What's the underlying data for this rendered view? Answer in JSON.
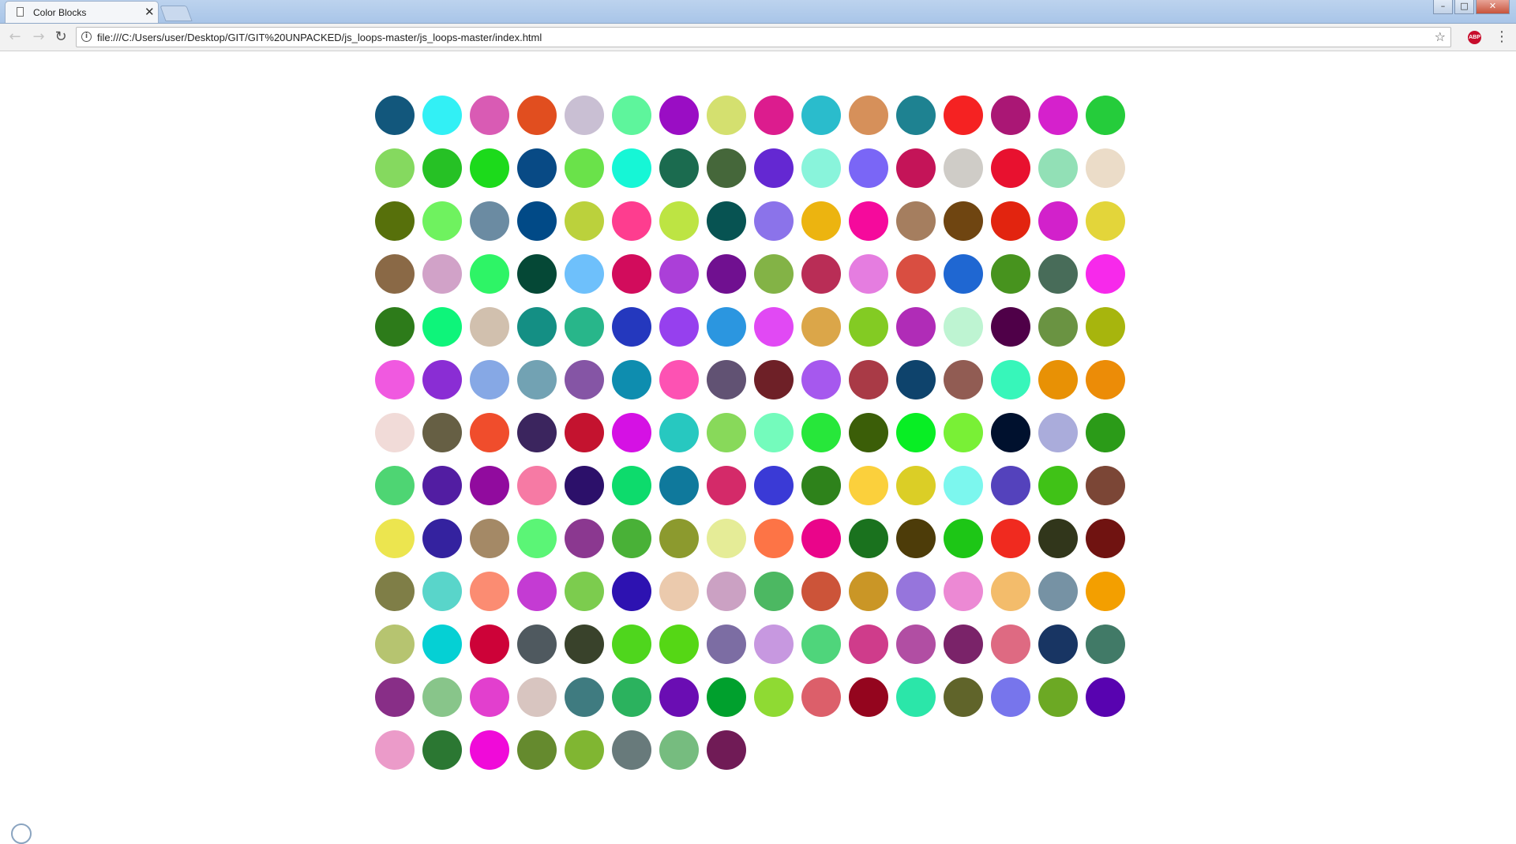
{
  "tab": {
    "title": "Color Blocks",
    "close_glyph": "✕"
  },
  "window_controls": {
    "minimize": "–",
    "maximize": "□",
    "close": "✕"
  },
  "toolbar": {
    "back": "←",
    "forward": "→",
    "reload": "↻",
    "url": "file:///C:/Users/user/Desktop/GIT/GIT%20UNPACKED/js_loops-master/js_loops-master/index.html",
    "info": "i",
    "star": "☆",
    "abp": "ABP",
    "menu": "⋮"
  },
  "icons": [
    "page-icon",
    "close-icon",
    "back-icon",
    "forward-icon",
    "reload-icon",
    "info-icon",
    "star-icon",
    "adblock-icon",
    "menu-icon"
  ],
  "page": {
    "columns": 16,
    "circles": [
      "#12577c",
      "#32f0f5",
      "#d95bb4",
      "#e14e1f",
      "#c9bfd3",
      "#5ef59c",
      "#9a0dc4",
      "#d4e06f",
      "#dc1c8e",
      "#2abccc",
      "#d6905a",
      "#1e8291",
      "#f52222",
      "#aa1775",
      "#d521cc",
      "#25cc3b",
      "#85d95f",
      "#26c125",
      "#1cda1b",
      "#084a85",
      "#6ae24a",
      "#16f6d6",
      "#1b6b4f",
      "#45673a",
      "#6428d2",
      "#89f4db",
      "#7a66f6",
      "#c41458",
      "#cfccc7",
      "#e8112f",
      "#92e0b6",
      "#ebdcc8",
      "#57700b",
      "#6ff25f",
      "#6b8ba2",
      "#014a87",
      "#bbd13c",
      "#fe3d8f",
      "#bde443",
      "#075352",
      "#8b73ea",
      "#ecb410",
      "#f50a9c",
      "#a57e5f",
      "#6f4511",
      "#e2240f",
      "#d221cb",
      "#e3d53a",
      "#8a6946",
      "#d1a2c8",
      "#2ef466",
      "#054836",
      "#6ec0fb",
      "#d20c5c",
      "#ab3fd8",
      "#701090",
      "#83b346",
      "#b92d56",
      "#e57de0",
      "#d94e41",
      "#1f67d2",
      "#47931e",
      "#486c59",
      "#f729eb",
      "#2d7b1a",
      "#0ef47a",
      "#d1c0ae",
      "#148f84",
      "#28b68a",
      "#2438be",
      "#9640ee",
      "#2b96e0",
      "#e149f4",
      "#dba649",
      "#83cb23",
      "#b02cb7",
      "#bef4d2",
      "#4f0048",
      "#6a9342",
      "#a7b50d",
      "#f059e0",
      "#8a2dd4",
      "#86a8e5",
      "#72a2b3",
      "#8555a5",
      "#0e8daf",
      "#fd52b3",
      "#615273",
      "#6e2027",
      "#a658ee",
      "#a93a46",
      "#0e436c",
      "#915c53",
      "#37f6ba",
      "#e89105",
      "#ec8c07",
      "#f1dbd8",
      "#665f44",
      "#f04d2c",
      "#3b255e",
      "#c4132f",
      "#d511e4",
      "#27c8c0",
      "#88d95a",
      "#74fbbc",
      "#27e73a",
      "#3b5e08",
      "#08ee24",
      "#79f036",
      "#00112e",
      "#aaacdb",
      "#2b9b18",
      "#4ed573",
      "#521da2",
      "#910b9e",
      "#f67aa4",
      "#2c106a",
      "#0ddb6c",
      "#0f799c",
      "#d42a69",
      "#3a3ad6",
      "#2e821b",
      "#fbd03c",
      "#dbce26",
      "#7cf7ee",
      "#5442bc",
      "#40c217",
      "#7b4636",
      "#ece54f",
      "#34229f",
      "#a48966",
      "#5bf576",
      "#8b3890",
      "#49b137",
      "#8c9a2e",
      "#e5ec97",
      "#fd7446",
      "#ea058a",
      "#1a721e",
      "#4d3c09",
      "#1dc616",
      "#f02a1f",
      "#31361b",
      "#701311",
      "#7f7e47",
      "#59d5ca",
      "#fb8c72",
      "#c43bd3",
      "#7ccc4e",
      "#2d12b1",
      "#ebcaad",
      "#cba1c3",
      "#4cb862",
      "#cc5439",
      "#ca9626",
      "#9675dc",
      "#ec89d4",
      "#f3bc6b",
      "#7692a4",
      "#f39f00",
      "#b6c470",
      "#05d0d4",
      "#cd0238",
      "#4f595f",
      "#39422b",
      "#4fd61d",
      "#55d715",
      "#7c6da3",
      "#c798e0",
      "#4fd57b",
      "#cf3c8b",
      "#b14ea3",
      "#7a2369",
      "#de6a82",
      "#183563",
      "#417a67",
      "#882e87",
      "#88c58a",
      "#e23fce",
      "#d8c5c0",
      "#3f7b80",
      "#2bb25e",
      "#6a0db3",
      "#00a02d",
      "#8fda33",
      "#dc5f6a",
      "#94051e",
      "#2be6a9",
      "#60642a",
      "#7775ec",
      "#6ca924",
      "#5803b0",
      "#eb9bc9",
      "#2b7732",
      "#f00ad9",
      "#658a2e",
      "#80b632",
      "#687a7b",
      "#76bc7f",
      "#701b56"
    ]
  }
}
